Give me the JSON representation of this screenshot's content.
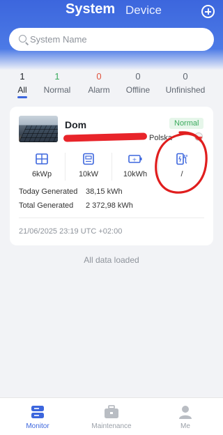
{
  "header": {
    "tabs": {
      "system": "System",
      "device": "Device"
    },
    "accent": "#3c66dd"
  },
  "search": {
    "placeholder": "System Name"
  },
  "status_filter": [
    {
      "count": "1",
      "label": "All",
      "selected": true
    },
    {
      "count": "1",
      "label": "Normal",
      "color": "#3aaa5c"
    },
    {
      "count": "0",
      "label": "Alarm",
      "color": "#e0523c"
    },
    {
      "count": "0",
      "label": "Offline"
    },
    {
      "count": "0",
      "label": "Unfinished"
    }
  ],
  "system_card": {
    "name": "Dom",
    "status": "Normal",
    "location": "Polska",
    "specs": [
      {
        "icon": "solar-panel-icon",
        "value": "6kWp"
      },
      {
        "icon": "inverter-icon",
        "value": "10kW"
      },
      {
        "icon": "battery-icon",
        "value": "10kWh"
      },
      {
        "icon": "ev-charger-icon",
        "value": "/"
      }
    ],
    "today_label": "Today Generated",
    "today_value": "38,15 kWh",
    "total_label": "Total Generated",
    "total_value": "2 372,98 kWh",
    "timestamp": "21/06/2025 23:19 UTC +02:00"
  },
  "list_footer": "All data loaded",
  "bottom_nav": [
    {
      "label": "Monitor",
      "icon": "monitor-icon",
      "active": true
    },
    {
      "label": "Maintenance",
      "icon": "toolbox-icon"
    },
    {
      "label": "Me",
      "icon": "person-icon"
    }
  ]
}
